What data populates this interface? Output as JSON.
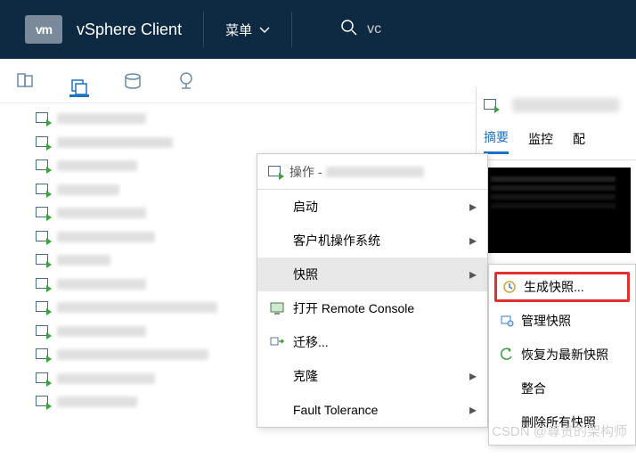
{
  "header": {
    "logo": "vm",
    "product": "vSphere Client",
    "menu_label": "菜单",
    "search_value": "vc"
  },
  "tree": {
    "item_count": 13
  },
  "context_menu": {
    "title_prefix": "操作 - ",
    "items": [
      {
        "label": "启动",
        "has_submenu": true,
        "icon": null
      },
      {
        "label": "客户机操作系统",
        "has_submenu": true,
        "icon": null
      },
      {
        "label": "快照",
        "has_submenu": true,
        "icon": null,
        "hover": true
      },
      {
        "label": "打开 Remote Console",
        "has_submenu": false,
        "icon": "console"
      },
      {
        "label": "迁移...",
        "has_submenu": false,
        "icon": "migrate"
      },
      {
        "label": "克隆",
        "has_submenu": true,
        "icon": null
      },
      {
        "label": "Fault Tolerance",
        "has_submenu": true,
        "icon": null
      }
    ]
  },
  "snapshot_submenu": {
    "items": [
      {
        "label": "生成快照...",
        "icon": "take-snapshot",
        "highlight": true
      },
      {
        "label": "管理快照",
        "icon": "manage-snapshot"
      },
      {
        "label": "恢复为最新快照",
        "icon": "revert-snapshot"
      },
      {
        "label": "整合",
        "icon": null
      },
      {
        "label": "删除所有快照",
        "icon": null
      }
    ]
  },
  "detail": {
    "tabs": [
      {
        "label": "摘要",
        "active": true
      },
      {
        "label": "监控",
        "active": false
      },
      {
        "label": "配",
        "active": false
      }
    ]
  },
  "watermark": "CSDN @尊贵的架构师"
}
